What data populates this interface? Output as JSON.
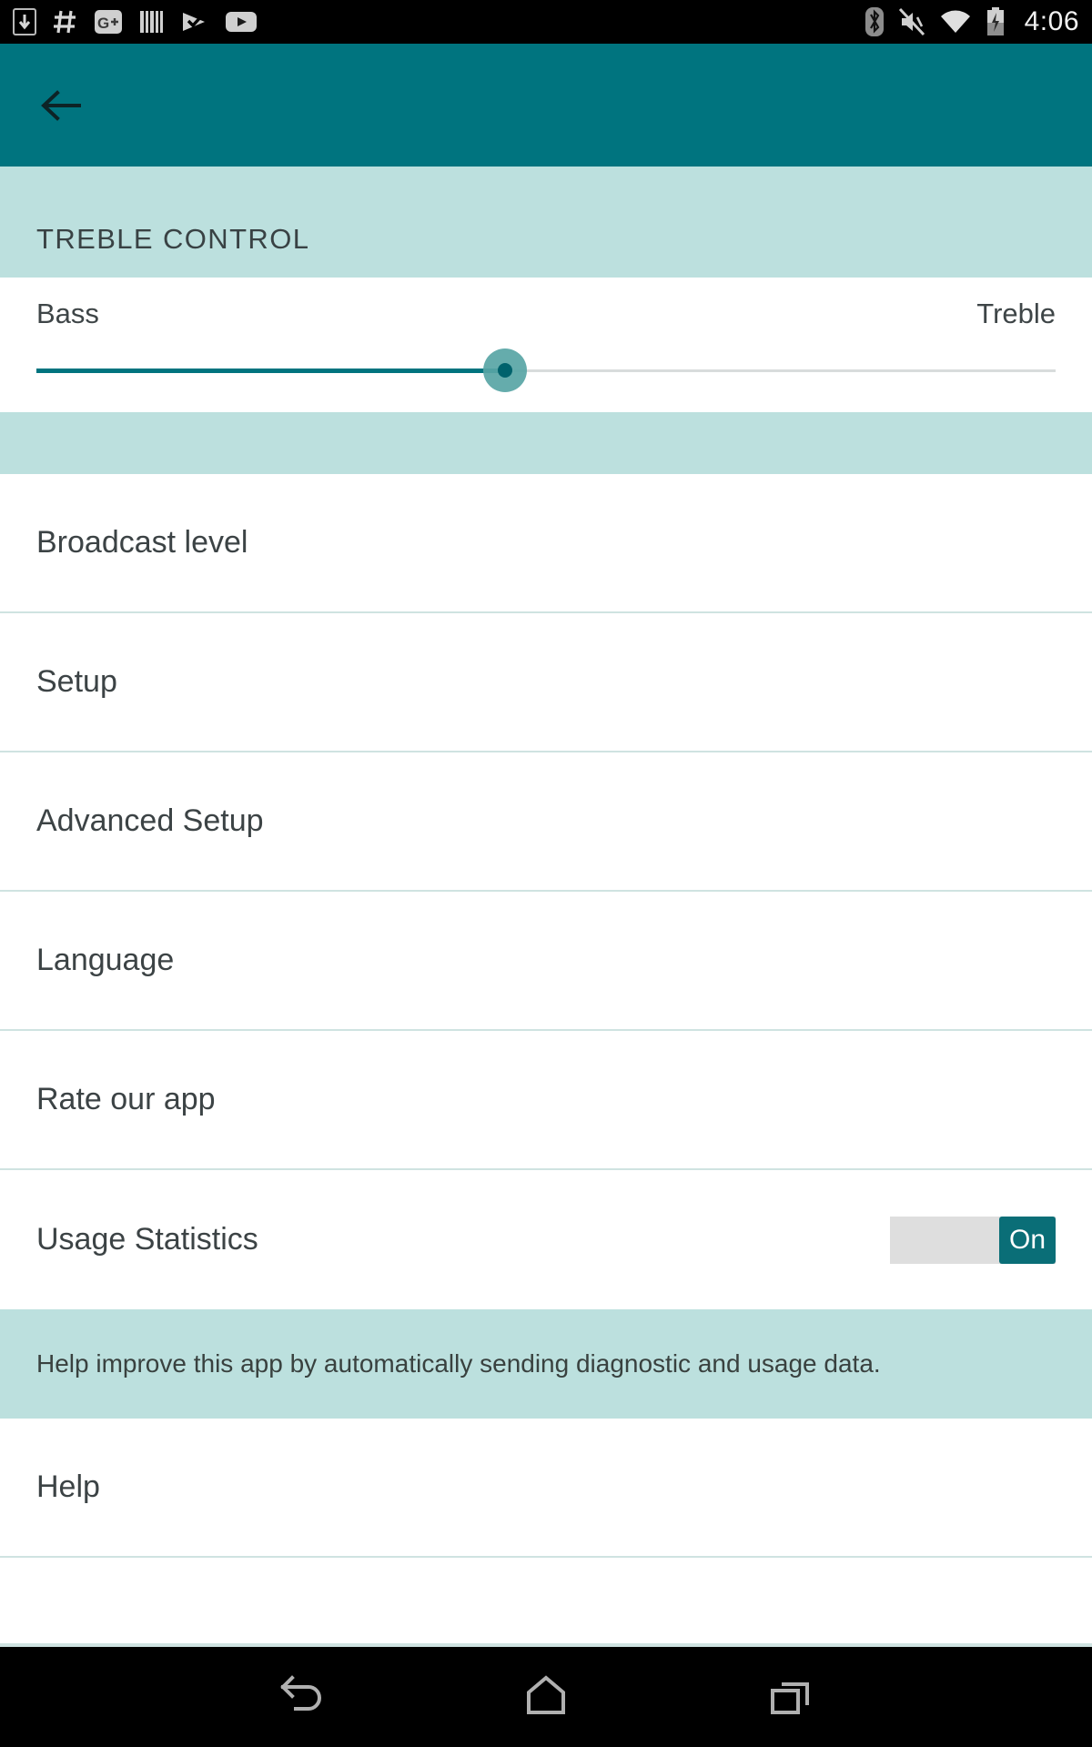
{
  "status_bar": {
    "time": "4:06",
    "left_icons": [
      {
        "name": "download-to-device-icon"
      },
      {
        "name": "hashtag-slack-icon"
      },
      {
        "name": "google-plus-icon"
      },
      {
        "name": "barcode-icon"
      },
      {
        "name": "play-protect-check-icon"
      },
      {
        "name": "youtube-icon"
      }
    ],
    "right_icons": [
      {
        "name": "bluetooth-icon"
      },
      {
        "name": "ringer-muted-icon"
      },
      {
        "name": "wifi-icon"
      },
      {
        "name": "battery-charging-icon"
      }
    ]
  },
  "app_bar": {
    "back_label": "Back",
    "background_color": "#00747F"
  },
  "section": {
    "title": "TREBLE CONTROL",
    "background_color": "#BCE0DE"
  },
  "slider": {
    "min_label": "Bass",
    "max_label": "Treble",
    "value_percent": 46,
    "fill_color": "#00747F",
    "track_color": "#d8dcdc",
    "thumb_color": "#58A5A5"
  },
  "list_items": [
    {
      "label": "Broadcast level",
      "type": "nav"
    },
    {
      "label": "Setup",
      "type": "nav"
    },
    {
      "label": "Advanced Setup",
      "type": "nav"
    },
    {
      "label": "Language",
      "type": "nav"
    },
    {
      "label": "Rate our app",
      "type": "nav"
    },
    {
      "label": "Usage Statistics",
      "type": "toggle"
    }
  ],
  "usage_statistics": {
    "label": "Usage Statistics",
    "toggle_state_label": "On",
    "toggle_on": true,
    "helper_text": "Help improve this app by automatically sending diagnostic and usage data.",
    "accent_color": "#0A6E77"
  },
  "help_item": {
    "label": "Help"
  },
  "nav_bar": {
    "buttons": [
      {
        "name": "back-nav-icon",
        "label": "Back"
      },
      {
        "name": "home-nav-icon",
        "label": "Home"
      },
      {
        "name": "recents-nav-icon",
        "label": "Recents"
      }
    ]
  }
}
